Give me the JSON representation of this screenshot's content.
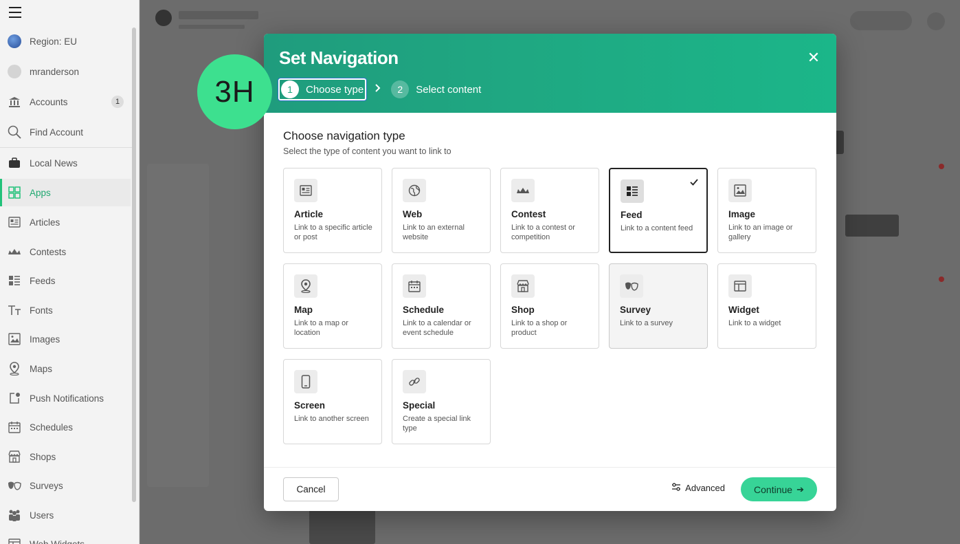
{
  "colors": {
    "accent": "#1fa882",
    "active_nav": "#22c27a",
    "step_marker": "#3de08f",
    "continue_button": "#37d497"
  },
  "sidebar": {
    "region": "Region: EU",
    "user": "mranderson",
    "items": [
      {
        "label": "Accounts",
        "icon": "bank-icon",
        "badge": "1"
      },
      {
        "label": "Find Account",
        "icon": "search-icon"
      },
      {
        "label": "Local News",
        "icon": "briefcase-icon"
      },
      {
        "label": "Apps",
        "icon": "grid-icon",
        "active": true
      },
      {
        "label": "Articles",
        "icon": "article-icon"
      },
      {
        "label": "Contests",
        "icon": "contest-icon"
      },
      {
        "label": "Feeds",
        "icon": "feed-icon"
      },
      {
        "label": "Fonts",
        "icon": "font-icon"
      },
      {
        "label": "Images",
        "icon": "image-icon"
      },
      {
        "label": "Maps",
        "icon": "map-pin-icon"
      },
      {
        "label": "Push Notifications",
        "icon": "notification-icon"
      },
      {
        "label": "Schedules",
        "icon": "calendar-icon"
      },
      {
        "label": "Shops",
        "icon": "shop-icon"
      },
      {
        "label": "Surveys",
        "icon": "survey-icon"
      },
      {
        "label": "Users",
        "icon": "users-icon"
      },
      {
        "label": "Web Widgets",
        "icon": "widget-icon"
      }
    ]
  },
  "step_marker": "3H",
  "modal": {
    "title": "Set Navigation",
    "steps": [
      {
        "number": "1",
        "label": "Choose type",
        "current": true
      },
      {
        "number": "2",
        "label": "Select content",
        "current": false
      }
    ],
    "section_title": "Choose navigation type",
    "section_subtitle": "Select the type of content you want to link to",
    "options": [
      {
        "name": "Article",
        "desc": "Link to a specific article or post",
        "icon": "article-icon"
      },
      {
        "name": "Web",
        "desc": "Link to an external website",
        "icon": "globe-icon"
      },
      {
        "name": "Contest",
        "desc": "Link to a contest or competition",
        "icon": "contest-icon"
      },
      {
        "name": "Feed",
        "desc": "Link to a content feed",
        "icon": "feed-icon",
        "selected": true
      },
      {
        "name": "Image",
        "desc": "Link to an image or gallery",
        "icon": "image-icon"
      },
      {
        "name": "Map",
        "desc": "Link to a map or location",
        "icon": "map-pin-icon"
      },
      {
        "name": "Schedule",
        "desc": "Link to a calendar or event schedule",
        "icon": "calendar-icon"
      },
      {
        "name": "Shop",
        "desc": "Link to a shop or product",
        "icon": "shop-icon"
      },
      {
        "name": "Survey",
        "desc": "Link to a survey",
        "icon": "survey-icon",
        "hover": true
      },
      {
        "name": "Widget",
        "desc": "Link to a widget",
        "icon": "widget-icon"
      },
      {
        "name": "Screen",
        "desc": "Link to another screen",
        "icon": "phone-icon"
      },
      {
        "name": "Special",
        "desc": "Create a special link type",
        "icon": "link-icon"
      }
    ],
    "footer": {
      "cancel": "Cancel",
      "advanced": "Advanced",
      "continue": "Continue"
    }
  }
}
